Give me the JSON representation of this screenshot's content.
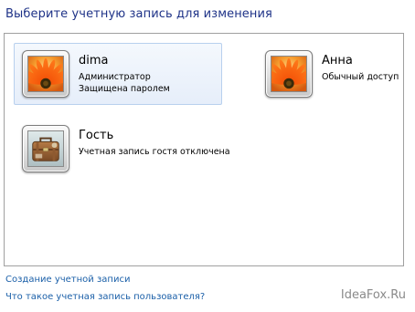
{
  "page": {
    "title": "Выберите учетную запись для изменения"
  },
  "accounts": [
    {
      "name": "dima",
      "line1": "Администратор",
      "line2": "Защищена паролем",
      "selected": true,
      "picture": "flower-icon"
    },
    {
      "name": "Анна",
      "line1": "Обычный доступ",
      "line2": "",
      "selected": false,
      "picture": "flower-icon"
    },
    {
      "name": "Гость",
      "line1": "Учетная запись гостя отключена",
      "line2": "",
      "selected": false,
      "picture": "suitcase-icon"
    }
  ],
  "links": {
    "create_account": "Создание учетной записи",
    "what_is_account": "Что такое учетная запись пользователя?"
  },
  "watermark": "IdeaFox.Ru"
}
